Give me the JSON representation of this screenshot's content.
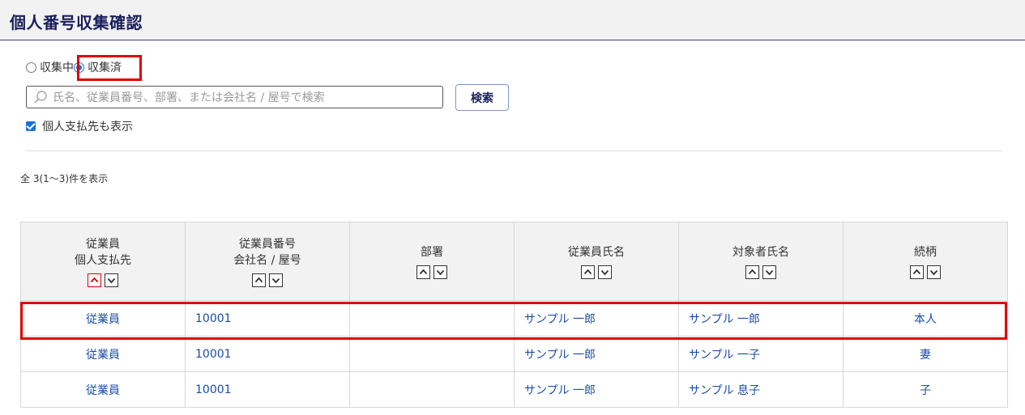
{
  "header": {
    "title": "個人番号収集確認"
  },
  "status": {
    "options": [
      {
        "label": "収集中",
        "checked": false
      },
      {
        "label": "収集済",
        "checked": true
      }
    ]
  },
  "search": {
    "placeholder": "氏名、従業員番号、部署、または会社名 / 屋号で検索",
    "button_label": "検索"
  },
  "filter": {
    "show_individual_payees_label": "個人支払先も表示",
    "checked": true
  },
  "result_count": "全 3(1〜3)件を表示",
  "table": {
    "headers": [
      {
        "line1": "従業員",
        "line2": "個人支払先"
      },
      {
        "line1": "従業員番号",
        "line2": "会社名 / 屋号"
      },
      {
        "line1": "部署",
        "line2": ""
      },
      {
        "line1": "従業員氏名",
        "line2": ""
      },
      {
        "line1": "対象者氏名",
        "line2": ""
      },
      {
        "line1": "続柄",
        "line2": ""
      }
    ],
    "rows": [
      {
        "type": "従業員",
        "number": "10001",
        "department": "",
        "employee_name": "サンプル 一郎",
        "target_name": "サンプル 一郎",
        "relation": "本人"
      },
      {
        "type": "従業員",
        "number": "10001",
        "department": "",
        "employee_name": "サンプル 一郎",
        "target_name": "サンプル 一子",
        "relation": "妻"
      },
      {
        "type": "従業員",
        "number": "10001",
        "department": "",
        "employee_name": "サンプル 一郎",
        "target_name": "サンプル 息子",
        "relation": "子"
      }
    ]
  },
  "colors": {
    "accent": "#1a6fd6",
    "title": "#1a1f5c",
    "link": "#1a4da8",
    "highlight": "#e00000"
  }
}
